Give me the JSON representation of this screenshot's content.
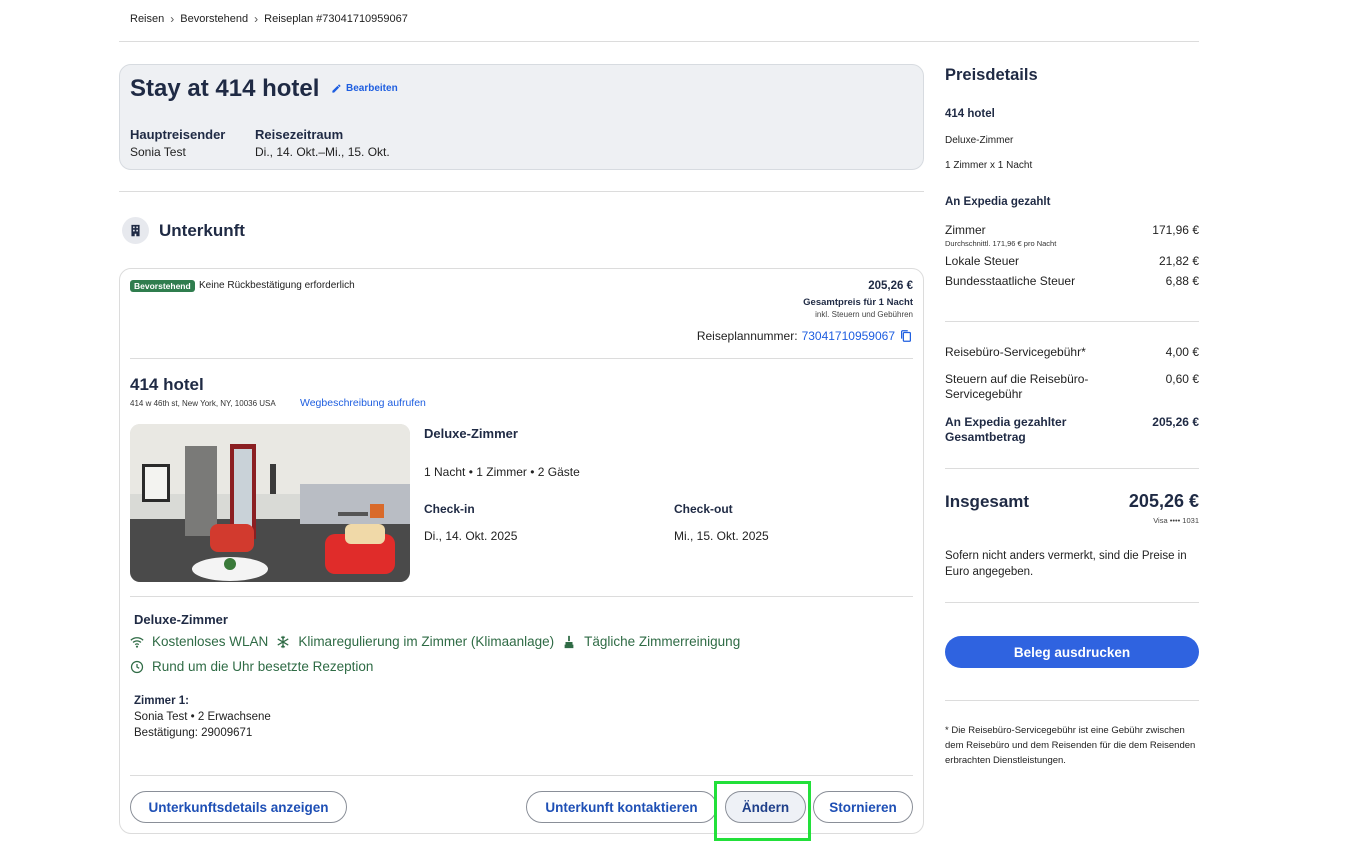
{
  "breadcrumb": {
    "items": [
      "Reisen",
      "Bevorstehend",
      "Reiseplan #73041710959067"
    ]
  },
  "summary": {
    "title": "Stay at 414 hotel",
    "edit_label": "Bearbeiten",
    "traveler_label": "Hauptreisender",
    "traveler_value": "Sonia Test",
    "period_label": "Reisezeitraum",
    "period_value": "Di., 14. Okt.–Mi., 15. Okt."
  },
  "section": {
    "title": "Unterkunft"
  },
  "booking": {
    "badge": "Bevorstehend",
    "badge_note": "Keine Rückbestätigung erforderlich",
    "price_total": "205,26 €",
    "price_caption": "Gesamtpreis für 1 Nacht",
    "price_note": "inkl. Steuern und Gebühren",
    "itinerary_label": "Reiseplannummer:",
    "itinerary_number": "73041710959067",
    "hotel_name": "414 hotel",
    "hotel_address": "414 w 46th st, New York, NY, 10036 USA",
    "directions_link": "Wegbeschreibung aufrufen",
    "room_type": "Deluxe-Zimmer",
    "room_meta": "1 Nacht • 1 Zimmer • 2 Gäste",
    "checkin_label": "Check-in",
    "checkin_value": "Di., 14. Okt. 2025",
    "checkout_label": "Check-out",
    "checkout_value": "Mi., 15. Okt. 2025",
    "amenities_title": "Deluxe-Zimmer",
    "amenities": {
      "wifi": "Kostenloses WLAN",
      "ac": "Klimaregulierung im Zimmer (Klimaanlage)",
      "cleaning": "Tägliche Zimmerreinigung",
      "reception": "Rund um die Uhr besetzte Rezeption"
    },
    "room1_title": "Zimmer 1:",
    "room1_guests": "Sonia Test • 2 Erwachsene",
    "room1_confirmation": "Bestätigung: 29009671",
    "buttons": {
      "details": "Unterkunftsdetails anzeigen",
      "contact": "Unterkunft kontaktieren",
      "change": "Ändern",
      "cancel": "Stornieren"
    }
  },
  "price_details": {
    "title": "Preisdetails",
    "hotel": "414 hotel",
    "room": "Deluxe-Zimmer",
    "room_count": "1 Zimmer x 1 Nacht",
    "paid_to_label": "An Expedia gezahlt",
    "room_label": "Zimmer",
    "room_value": "171,96 €",
    "room_avg": "Durchschnittl. 171,96 € pro Nacht",
    "local_tax_label": "Lokale Steuer",
    "local_tax_value": "21,82 €",
    "state_tax_label": "Bundesstaatliche Steuer",
    "state_tax_value": "6,88 €",
    "service_fee_label": "Reisebüro-Servicegebühr*",
    "service_fee_value": "4,00 €",
    "service_tax_label_1": "Steuern auf die Reisebüro-",
    "service_tax_label_2": "Servicegebühr",
    "service_tax_value": "0,60 €",
    "expedia_total_label_1": "An Expedia gezahlter",
    "expedia_total_label_2": "Gesamtbetrag",
    "expedia_total_value": "205,26 €",
    "total_label": "Insgesamt",
    "total_value": "205,26 €",
    "card": "Visa •••• 1031",
    "currency_note": "Sofern nicht anders vermerkt, sind die Preise in Euro angegeben.",
    "print_button": "Beleg ausdrucken",
    "footnote": "* Die Reisebüro-Servicegebühr ist eine Gebühr zwischen dem Reisebüro und dem Reisenden für die dem Reisenden erbrachten Dienstleistungen."
  },
  "colors": {
    "brand_blue": "#1e5ee0",
    "primary_button": "#2f63e0",
    "badge_green": "#2f7d4e",
    "amenity_green": "#2f6b45",
    "highlight": "#22e03a"
  }
}
